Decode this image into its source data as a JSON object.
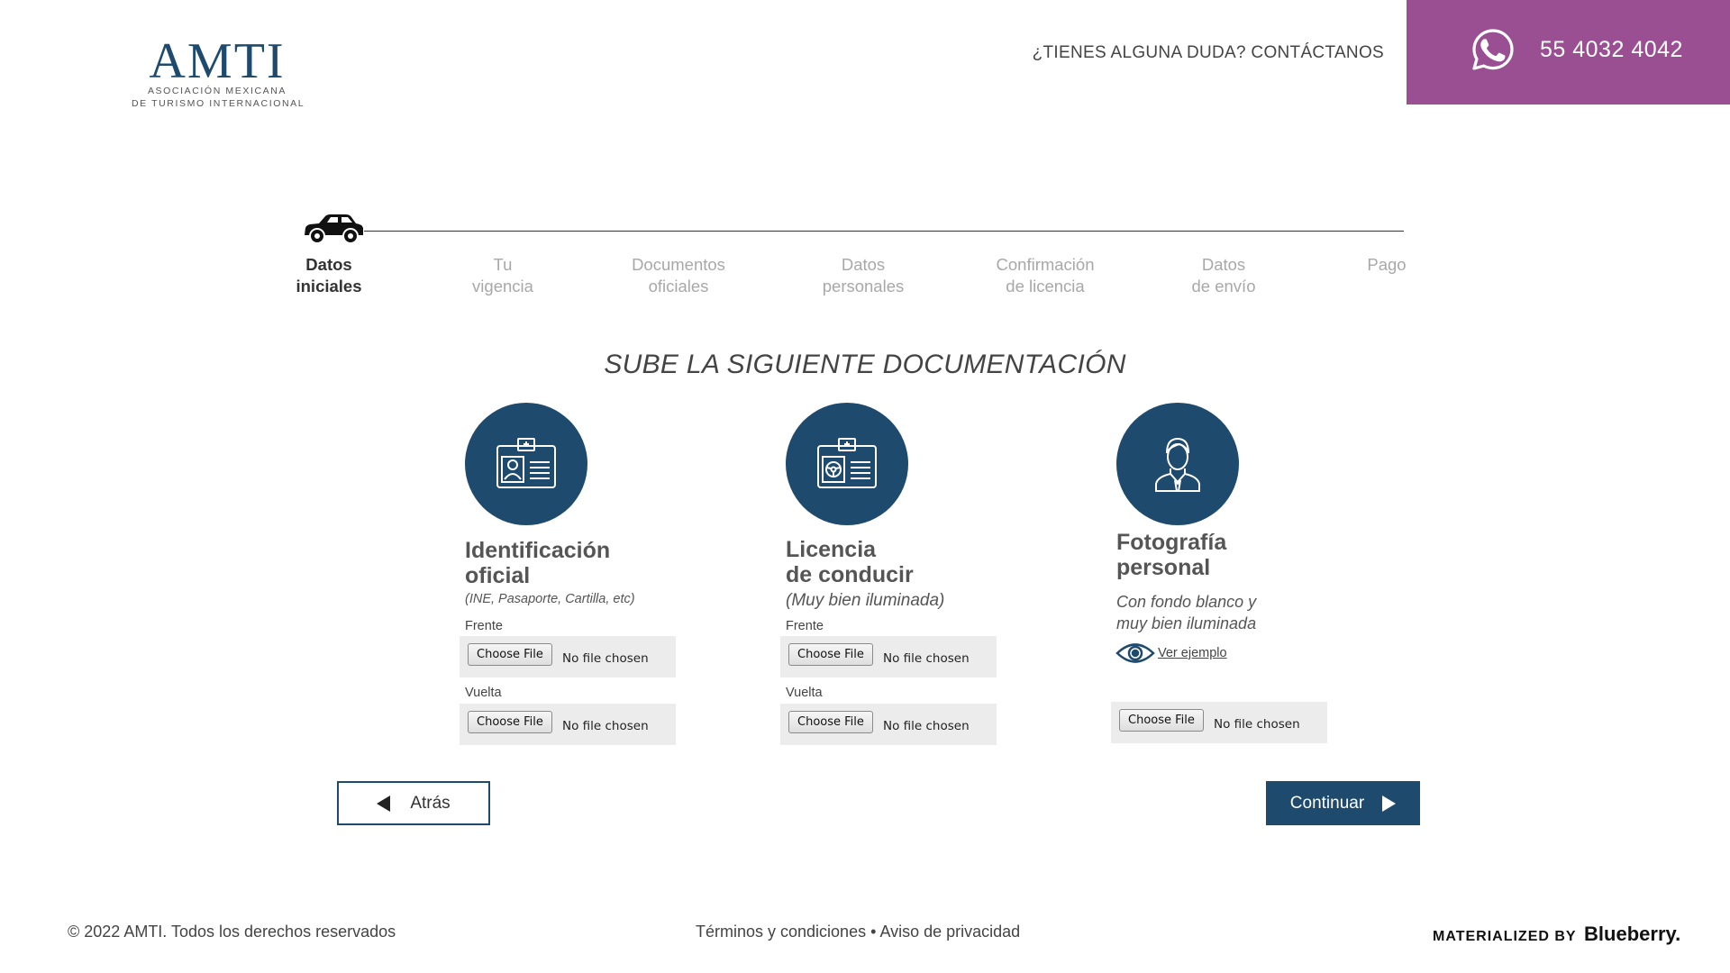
{
  "header": {
    "logo_main": "AMTI",
    "logo_line1": "ASOCIACIÓN MEXICANA",
    "logo_line2": "DE TURISMO INTERNACIONAL",
    "contact_text": "¿TIENES ALGUNA DUDA? CONTÁCTANOS",
    "phone": "55 4032 4042",
    "phone_bg_color": "#9a4f92"
  },
  "stepper": {
    "steps": [
      {
        "line1": "Datos",
        "line2": "iniciales",
        "active": true
      },
      {
        "line1": "Tu",
        "line2": "vigencia",
        "active": false
      },
      {
        "line1": "Documentos",
        "line2": "oficiales",
        "active": false
      },
      {
        "line1": "Datos",
        "line2": "personales",
        "active": false
      },
      {
        "line1": "Confirmación",
        "line2": "de licencia",
        "active": false
      },
      {
        "line1": "Datos",
        "line2": "de envío",
        "active": false
      },
      {
        "line1": "Pago",
        "line2": "",
        "active": false
      }
    ]
  },
  "section_title": "SUBE LA SIGUIENTE DOCUMENTACIÓN",
  "documents": [
    {
      "icon": "id-card-icon",
      "title_line1": "Identificación",
      "title_line2": "oficial",
      "note": "(INE, Pasaporte, Cartilla, etc)",
      "front_label": "Frente",
      "back_label": "Vuelta",
      "button_label": "Choose File",
      "status": "No file chosen"
    },
    {
      "icon": "driver-license-icon",
      "title_line1": "Licencia",
      "title_line2": "de conducir",
      "note": "(Muy bien iluminada)",
      "front_label": "Frente",
      "back_label": "Vuelta",
      "button_label": "Choose File",
      "status": "No file chosen"
    },
    {
      "icon": "person-portrait-icon",
      "title_line1": "Fotografía",
      "title_line2": "personal",
      "note_line1": "Con fondo blanco y",
      "note_line2": "muy bien iluminada",
      "see_example": "Ver ejemplo",
      "button_label": "Choose File",
      "status": "No file chosen"
    }
  ],
  "actions": {
    "back_label": "Atrás",
    "next_label": "Continuar"
  },
  "footer": {
    "copyright": "© 2022 AMTI. Todos los derechos reservados",
    "terms": "Términos y condiciones",
    "separator": "•",
    "privacy": "Aviso de privacidad",
    "materialized_by": "MATERIALIZED BY",
    "brand": "Blueberry."
  },
  "colors": {
    "primary": "#1e4a6d",
    "accent": "#9a4f92"
  }
}
